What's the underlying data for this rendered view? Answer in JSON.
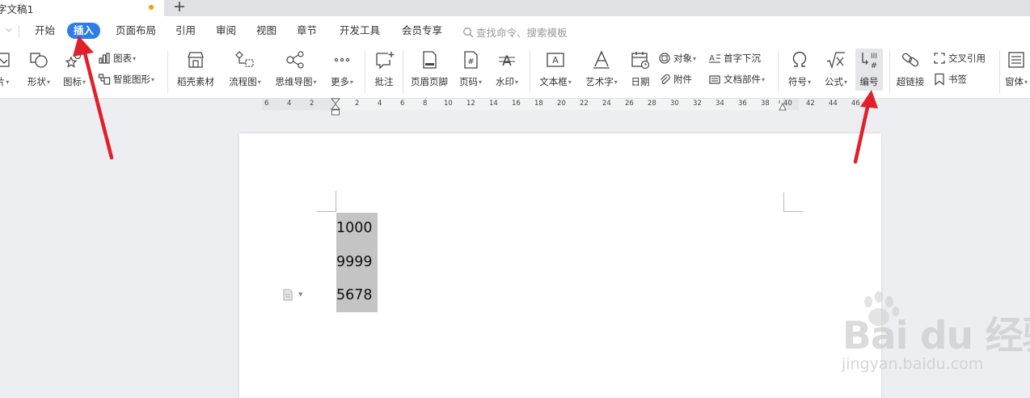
{
  "window": {
    "doc_title": "字文稿1",
    "new_tab": "+"
  },
  "menu": {
    "items": [
      "开始",
      "插入",
      "页面布局",
      "引用",
      "审阅",
      "视图",
      "章节",
      "开发工具",
      "会员专享"
    ],
    "active": "插入",
    "search_placeholder": "查找命令、搜索模板"
  },
  "ribbon": {
    "picture": "片",
    "shape": "形状",
    "icon_lib": "图标",
    "chart": "图表",
    "smart_art": "智能图形",
    "daoke": "稻壳素材",
    "flowchart": "流程图",
    "mindmap": "思维导图",
    "more": "更多",
    "comment": "批注",
    "header_footer": "页眉页脚",
    "page_number": "页码",
    "watermark": "水印",
    "textbox": "文本框",
    "wordart": "艺术字",
    "date": "日期",
    "object": "对象",
    "drop_cap": "首字下沉",
    "attachment": "附件",
    "doc_parts": "文档部件",
    "symbol": "符号",
    "formula": "公式",
    "numbering": "编号",
    "hyperlink": "超链接",
    "cross_ref": "交叉引用",
    "bookmark": "书签",
    "window": "窗体"
  },
  "ruler": {
    "ticks": [
      "6",
      "4",
      "2",
      "2",
      "4",
      "6",
      "8",
      "10",
      "12",
      "14",
      "16",
      "18",
      "20",
      "22",
      "24",
      "26",
      "28",
      "30",
      "32",
      "34",
      "36",
      "38",
      "40",
      "42",
      "44",
      "46"
    ]
  },
  "document": {
    "lines": [
      "1000",
      "9999",
      "5678"
    ]
  },
  "watermark": {
    "main": "Bai du 经验",
    "sub": "jingyan.baidu.com"
  },
  "colors": {
    "accent": "#2f7bea",
    "arrow": "#e0202a",
    "selection": "#c4c4c4",
    "unsaved": "#ff9b00"
  }
}
